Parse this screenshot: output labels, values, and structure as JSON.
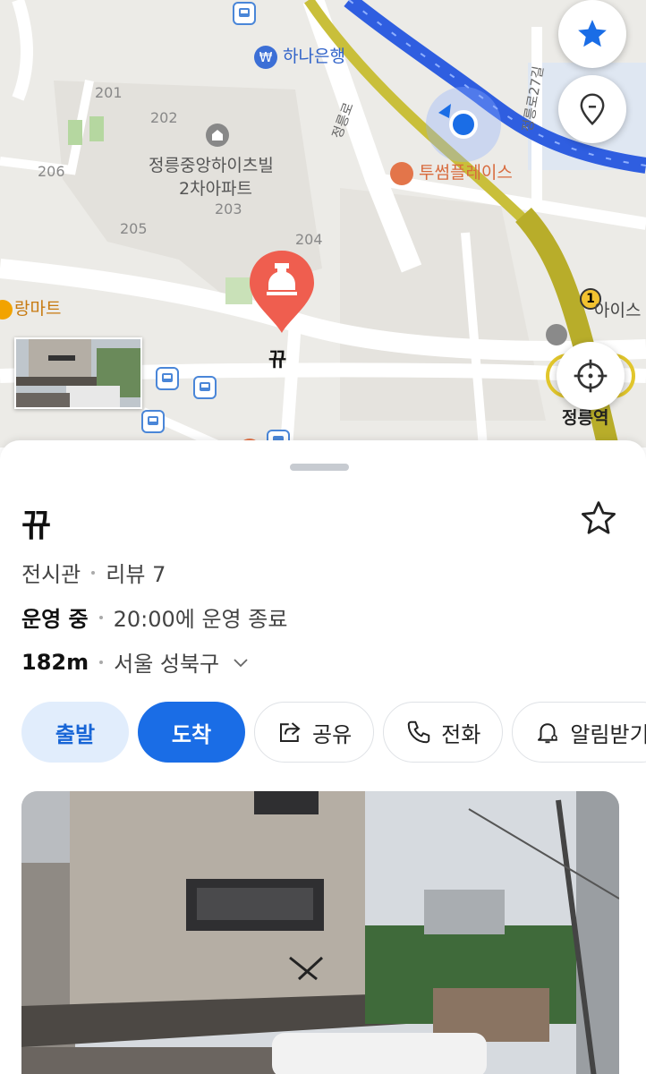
{
  "map": {
    "labels": {
      "bank": "하나은행",
      "apartment_line1": "정릉중앙하이츠빌",
      "apartment_line2": "2차아파트",
      "cafe": "투썸플레이스",
      "mart": "랑마트",
      "road_vertical": "정릉로",
      "road_side": "정릉로27길",
      "station": "정릉역",
      "partial_poi": "아이스"
    },
    "building_numbers": [
      "201",
      "202",
      "203",
      "204",
      "205",
      "206"
    ],
    "badge_number": "1",
    "pin_label": "뀨"
  },
  "place": {
    "name": "뀨",
    "category": "전시관",
    "review_label": "리뷰",
    "review_count": "7",
    "status": "운영 중",
    "hours": "20:00에 운영 종료",
    "distance": "182m",
    "region": "서울 성북구"
  },
  "actions": {
    "depart": "출발",
    "arrive": "도착",
    "share": "공유",
    "call": "전화",
    "notify": "알림받기"
  },
  "colors": {
    "accent_blue": "#1a6de6",
    "light_blue": "#e1edfc",
    "pin_red": "#ef5e4f",
    "route_blue": "#2f5ee0"
  }
}
